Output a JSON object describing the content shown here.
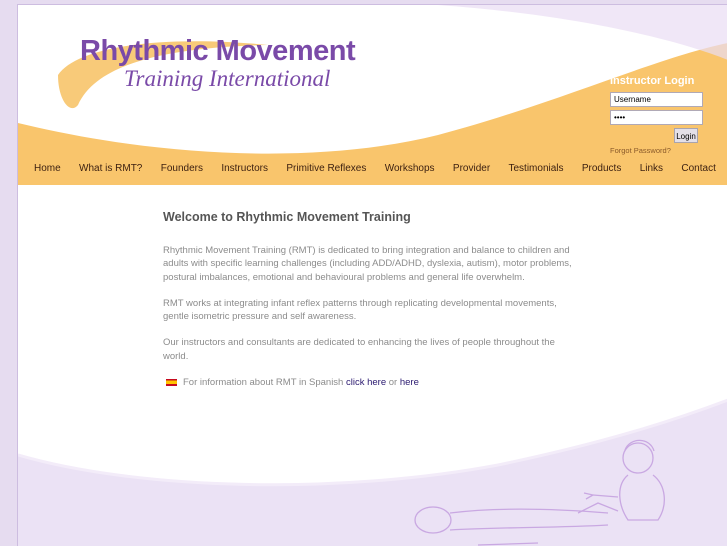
{
  "logo": {
    "line1": "Rhythmic Movement",
    "line2": "Training International"
  },
  "login": {
    "title": "Instructor Login",
    "username_value": "Username",
    "password_value": "****",
    "button_label": "Login",
    "forgot_label": "Forgot Password?"
  },
  "nav": {
    "items": [
      {
        "label": "Home"
      },
      {
        "label": "What is RMT?"
      },
      {
        "label": "Founders"
      },
      {
        "label": "Instructors"
      },
      {
        "label": "Primitive Reflexes"
      },
      {
        "label": "Workshops"
      },
      {
        "label": "Provider"
      },
      {
        "label": "Testimonials"
      },
      {
        "label": "Products"
      },
      {
        "label": "Links"
      },
      {
        "label": "Contact"
      }
    ]
  },
  "content": {
    "heading": "Welcome to Rhythmic Movement Training",
    "paragraphs": [
      "Rhythmic Movement Training (RMT) is dedicated to bring integration and balance to children and adults with specific learning challenges (including ADD/ADHD, dyslexia, autism), motor problems, postural imbalances, emotional and behavioural problems and general life overwhelm.",
      "RMT works at integrating infant reflex patterns through replicating developmental movements, gentle isometric pressure and self awareness.",
      "Our instructors and consultants are dedicated to enhancing the lives of people throughout the world."
    ],
    "spanish": {
      "text": "For information about RMT in Spanish",
      "link1": "click here",
      "connector": "or",
      "link2": "here"
    }
  },
  "colors": {
    "accent_orange": "#f9c56c",
    "brand_purple": "#7a4aa8",
    "page_background": "#e6dcf0"
  }
}
